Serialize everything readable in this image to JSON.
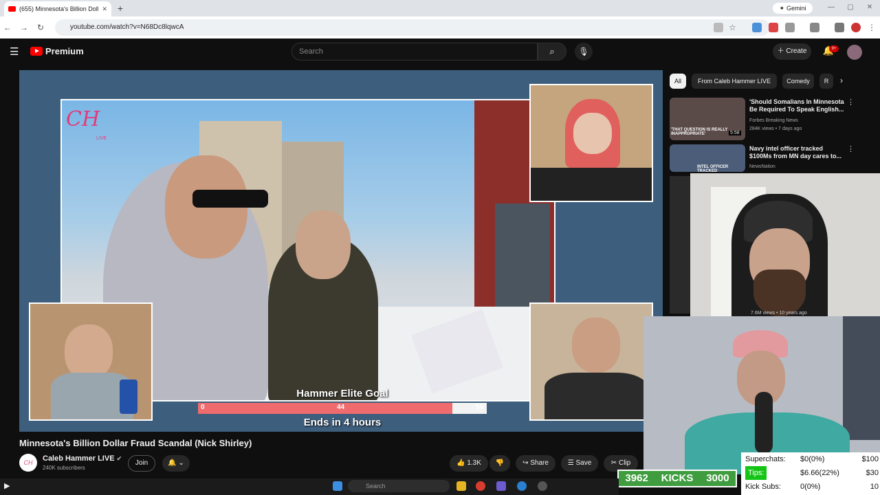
{
  "browser": {
    "tab_title": "(655) Minnesota's Billion Dollar Fra...",
    "new_tab": "+",
    "url": "youtube.com/watch?v=N68Dc8lqwcA",
    "gemini": "Gemini",
    "window_min": "—",
    "window_max": "▢",
    "window_close": "✕"
  },
  "youtube": {
    "logo_text": "Premium",
    "search_placeholder": "Search",
    "create_label": "Create",
    "notif_count": "9+"
  },
  "video": {
    "overlay_logo": "CH",
    "overlay_logo_sub": "LIVE",
    "goal_title": "Hammer Elite Goal",
    "goal_min": "0",
    "goal_current": "44",
    "goal_max": "50",
    "goal_progress": 0.88,
    "goal_ends": "Ends in 4 hours",
    "title": "Minnesota's Billion Dollar Fraud Scandal (Nick Shirley)"
  },
  "channel": {
    "avatar_text": "CH",
    "name": "Caleb Hammer LIVE",
    "subscribers": "240K subscribers",
    "join": "Join"
  },
  "actions": {
    "likes": "1.3K",
    "share": "Share",
    "save": "Save",
    "clip": "Clip"
  },
  "sidebar": {
    "chips": [
      "All",
      "From Caleb Hammer LIVE",
      "Comedy",
      "R"
    ],
    "videos": [
      {
        "title": "'Should Somalians In Minnesota Be Required To Speak English...",
        "channel": "Forbes Breaking News",
        "meta": "284K views • 7 days ago",
        "thumb_text": "'THAT QUESTION IS REALLY INAPPROPRIATE'",
        "duration": "5:58"
      },
      {
        "title": "Navy intel officer tracked $100Ms from MN day cares to...",
        "channel": "NewsNation",
        "meta": "",
        "thumb_text": "INTEL OFFICER TRACKED",
        "duration": ""
      }
    ],
    "hidden_meta": "7.6M views • 10 years ago"
  },
  "stream": {
    "kicks_count": "3962",
    "kicks_label": "KICKS",
    "kicks_goal": "3000",
    "stats": [
      {
        "label": "Superchats:",
        "value": "$0(0%)",
        "goal": "$100",
        "highlight": false
      },
      {
        "label": "Tips:",
        "value": "$6.66(22%)",
        "goal": "$30",
        "highlight": true
      },
      {
        "label": "Kick Subs:",
        "value": "0(0%)",
        "goal": "10",
        "highlight": false
      }
    ]
  },
  "taskbar": {
    "search_placeholder": "Search"
  }
}
